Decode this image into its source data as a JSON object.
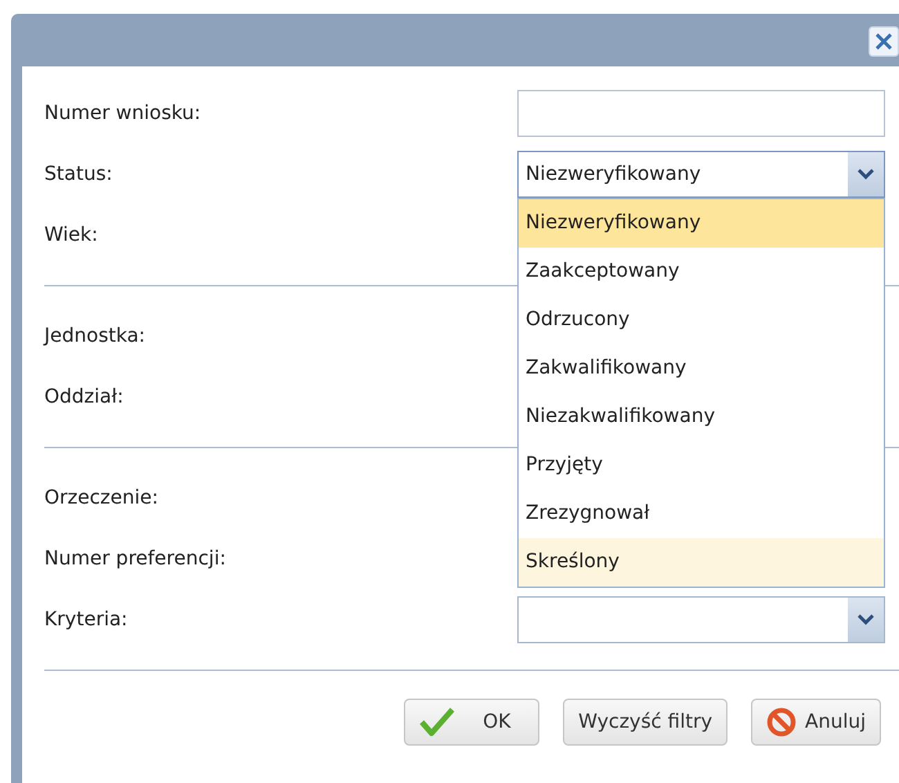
{
  "sections": [
    {
      "fields": [
        {
          "label": "Numer wniosku:",
          "kind": "input"
        },
        {
          "label": "Status:",
          "kind": "select",
          "value": "Niezweryfikowany",
          "open": true
        },
        {
          "label": "Wiek:",
          "kind": "hidden"
        }
      ]
    },
    {
      "fields": [
        {
          "label": "Jednostka:",
          "kind": "hidden"
        },
        {
          "label": "Oddział:",
          "kind": "hidden"
        }
      ]
    },
    {
      "fields": [
        {
          "label": "Orzeczenie:",
          "kind": "hidden"
        },
        {
          "label": "Numer preferencji:",
          "kind": "hidden"
        },
        {
          "label": "Kryteria:",
          "kind": "select",
          "open": false
        }
      ]
    }
  ],
  "dropdown": [
    {
      "label": "Niezweryfikowany",
      "selected": true,
      "hovered": false
    },
    {
      "label": "Zaakceptowany",
      "selected": false,
      "hovered": false
    },
    {
      "label": "Odrzucony",
      "selected": false,
      "hovered": false
    },
    {
      "label": "Zakwalifikowany",
      "selected": false,
      "hovered": false
    },
    {
      "label": "Niezakwalifikowany",
      "selected": false,
      "hovered": false
    },
    {
      "label": "Przyjęty",
      "selected": false,
      "hovered": false
    },
    {
      "label": "Zrezygnował",
      "selected": false,
      "hovered": false
    },
    {
      "label": "Skreślony",
      "selected": false,
      "hovered": true
    }
  ],
  "buttons": [
    {
      "label": "OK",
      "kind": "ok"
    },
    {
      "label": "Wyczyść filtry",
      "kind": "plain"
    },
    {
      "label": "Anuluj",
      "kind": "cancel"
    }
  ]
}
